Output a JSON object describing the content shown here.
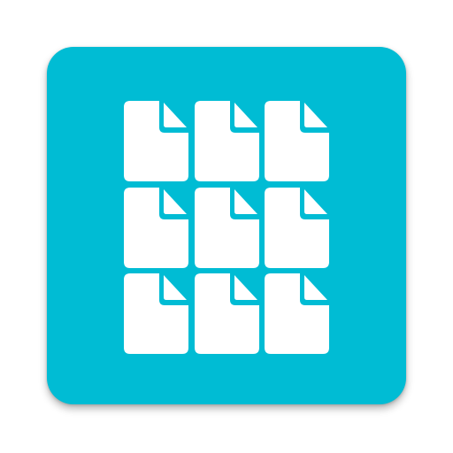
{
  "app_icon": {
    "icon_name": "document-grid-icon",
    "background_color": "#00BCD4",
    "foreground_color": "#FFFFFF",
    "documents": [
      {
        "icon": "document-icon"
      },
      {
        "icon": "document-icon"
      },
      {
        "icon": "document-icon"
      },
      {
        "icon": "document-icon"
      },
      {
        "icon": "document-icon"
      },
      {
        "icon": "document-icon"
      },
      {
        "icon": "document-icon"
      },
      {
        "icon": "document-icon"
      },
      {
        "icon": "document-icon"
      }
    ]
  }
}
